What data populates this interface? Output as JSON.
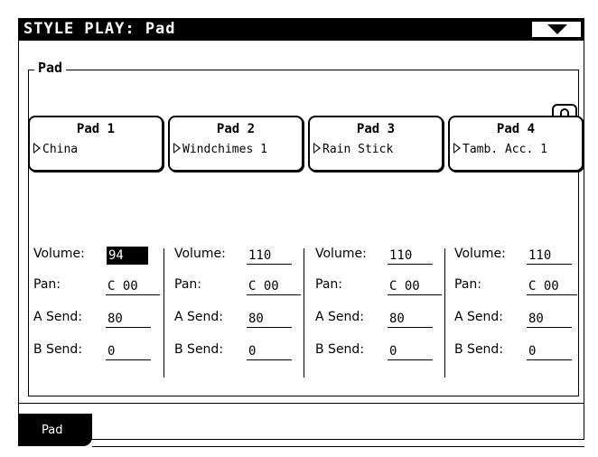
{
  "window": {
    "title": "STYLE PLAY: Pad",
    "menu_icon": "triangle-down-icon"
  },
  "group": {
    "title": "Pad",
    "lock_icon": "lock-icon"
  },
  "pads": [
    {
      "name": "Pad 1",
      "sound": "China"
    },
    {
      "name": "Pad 2",
      "sound": "Windchimes 1"
    },
    {
      "name": "Pad 3",
      "sound": "Rain Stick"
    },
    {
      "name": "Pad 4",
      "sound": "Tamb. Acc. 1"
    }
  ],
  "params": [
    {
      "volume_label": "Volume:",
      "volume": "94",
      "pan_label": "Pan:",
      "pan": "C 00",
      "asend_label": "A Send:",
      "asend": "80",
      "bsend_label": "B Send:",
      "bsend": "0"
    },
    {
      "volume_label": "Volume:",
      "volume": "110",
      "pan_label": "Pan:",
      "pan": "C 00",
      "asend_label": "A Send:",
      "asend": "80",
      "bsend_label": "B Send:",
      "bsend": "0"
    },
    {
      "volume_label": "Volume:",
      "volume": "110",
      "pan_label": "Pan:",
      "pan": "C 00",
      "asend_label": "A Send:",
      "asend": "80",
      "bsend_label": "B Send:",
      "bsend": "0"
    },
    {
      "volume_label": "Volume:",
      "volume": "110",
      "pan_label": "Pan:",
      "pan": "C 00",
      "asend_label": "A Send:",
      "asend": "80",
      "bsend_label": "B Send:",
      "bsend": "0"
    }
  ],
  "tabs": [
    {
      "label": "Pad",
      "active": true
    }
  ]
}
